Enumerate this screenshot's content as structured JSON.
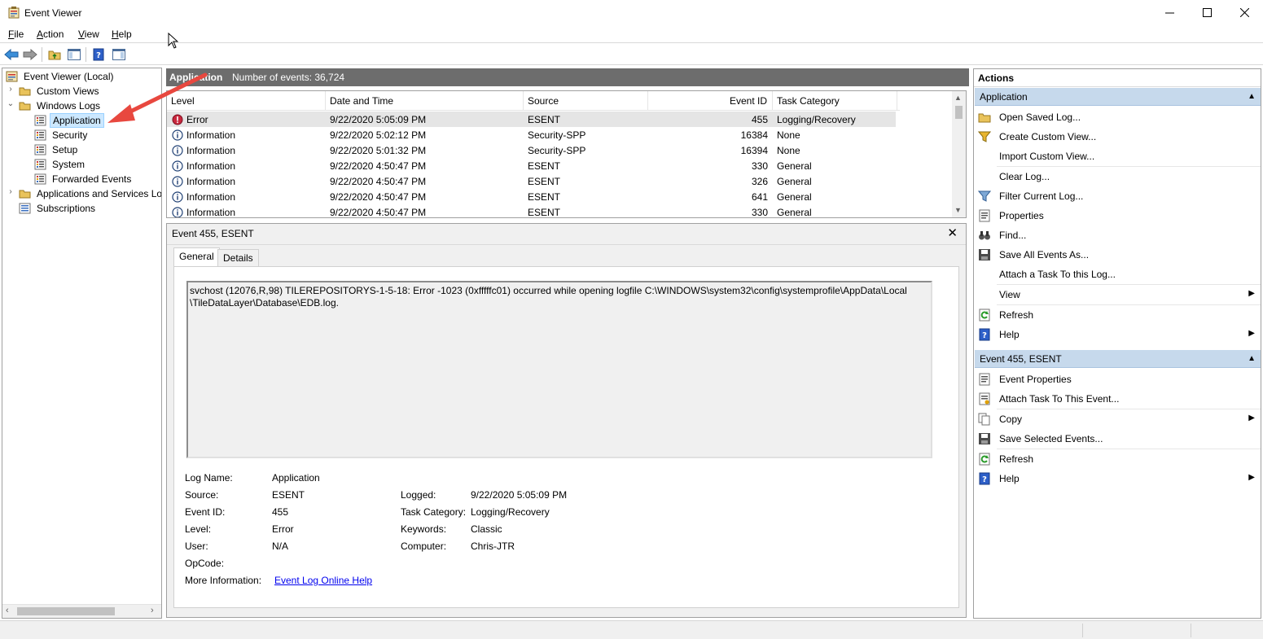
{
  "window": {
    "title": "Event Viewer"
  },
  "menu": [
    {
      "pre": "",
      "key": "F",
      "post": "ile"
    },
    {
      "pre": "",
      "key": "A",
      "post": "ction"
    },
    {
      "pre": "",
      "key": "V",
      "post": "iew"
    },
    {
      "pre": "",
      "key": "H",
      "post": "elp"
    }
  ],
  "tree": {
    "root": "Event Viewer (Local)",
    "custom_views": "Custom Views",
    "windows_logs": "Windows Logs",
    "application": "Application",
    "security": "Security",
    "setup": "Setup",
    "system": "System",
    "forwarded": "Forwarded Events",
    "apps_services": "Applications and Services Lo",
    "subscriptions": "Subscriptions"
  },
  "middle": {
    "header_title": "Application",
    "header_count": "Number of events: 36,724",
    "columns": [
      "Level",
      "Date and Time",
      "Source",
      "Event ID",
      "Task Category"
    ],
    "rows": [
      {
        "level": "Error",
        "type": "error",
        "date": "9/22/2020 5:05:09 PM",
        "source": "ESENT",
        "id": "455",
        "category": "Logging/Recovery"
      },
      {
        "level": "Information",
        "type": "info",
        "date": "9/22/2020 5:02:12 PM",
        "source": "Security-SPP",
        "id": "16384",
        "category": "None"
      },
      {
        "level": "Information",
        "type": "info",
        "date": "9/22/2020 5:01:32 PM",
        "source": "Security-SPP",
        "id": "16394",
        "category": "None"
      },
      {
        "level": "Information",
        "type": "info",
        "date": "9/22/2020 4:50:47 PM",
        "source": "ESENT",
        "id": "330",
        "category": "General"
      },
      {
        "level": "Information",
        "type": "info",
        "date": "9/22/2020 4:50:47 PM",
        "source": "ESENT",
        "id": "326",
        "category": "General"
      },
      {
        "level": "Information",
        "type": "info",
        "date": "9/22/2020 4:50:47 PM",
        "source": "ESENT",
        "id": "641",
        "category": "General"
      },
      {
        "level": "Information",
        "type": "info",
        "date": "9/22/2020 4:50:47 PM",
        "source": "ESENT",
        "id": "330",
        "category": "General"
      }
    ]
  },
  "detail": {
    "title": "Event 455, ESENT",
    "tabs": [
      "General",
      "Details"
    ],
    "description": "svchost (12076,R,98) TILEREPOSITORYS-1-5-18: Error -1023 (0xfffffc01) occurred while opening logfile C:\\WINDOWS\\system32\\config\\systemprofile\\AppData\\Local\n\\TileDataLayer\\Database\\EDB.log.",
    "labels": {
      "log_name": "Log Name:",
      "source": "Source:",
      "event_id": "Event ID:",
      "level": "Level:",
      "user": "User:",
      "opcode": "OpCode:",
      "more_info": "More Information:",
      "logged": "Logged:",
      "task_category": "Task Category:",
      "keywords": "Keywords:",
      "computer": "Computer:"
    },
    "values": {
      "log_name": "Application",
      "source": "ESENT",
      "event_id": "455",
      "level": "Error",
      "user": "N/A",
      "logged": "9/22/2020 5:05:09 PM",
      "task_category": "Logging/Recovery",
      "keywords": "Classic",
      "computer": "Chris-JTR",
      "help_link": "Event Log Online Help"
    }
  },
  "actions": {
    "title": "Actions",
    "section1": "Application",
    "section1_items": [
      "Open Saved Log...",
      "Create Custom View...",
      "Import Custom View...",
      "Clear Log...",
      "Filter Current Log...",
      "Properties",
      "Find...",
      "Save All Events As...",
      "Attach a Task To this Log...",
      "View",
      "Refresh",
      "Help"
    ],
    "section2": "Event 455, ESENT",
    "section2_items": [
      "Event Properties",
      "Attach Task To This Event...",
      "Copy",
      "Save Selected Events...",
      "Refresh",
      "Help"
    ]
  },
  "colors": {
    "selection": "#cce8ff",
    "section_header": "#c6d9ec",
    "pane_header": "#6d6d6d",
    "arrow": "#e8483f",
    "link": "#0000ee"
  }
}
